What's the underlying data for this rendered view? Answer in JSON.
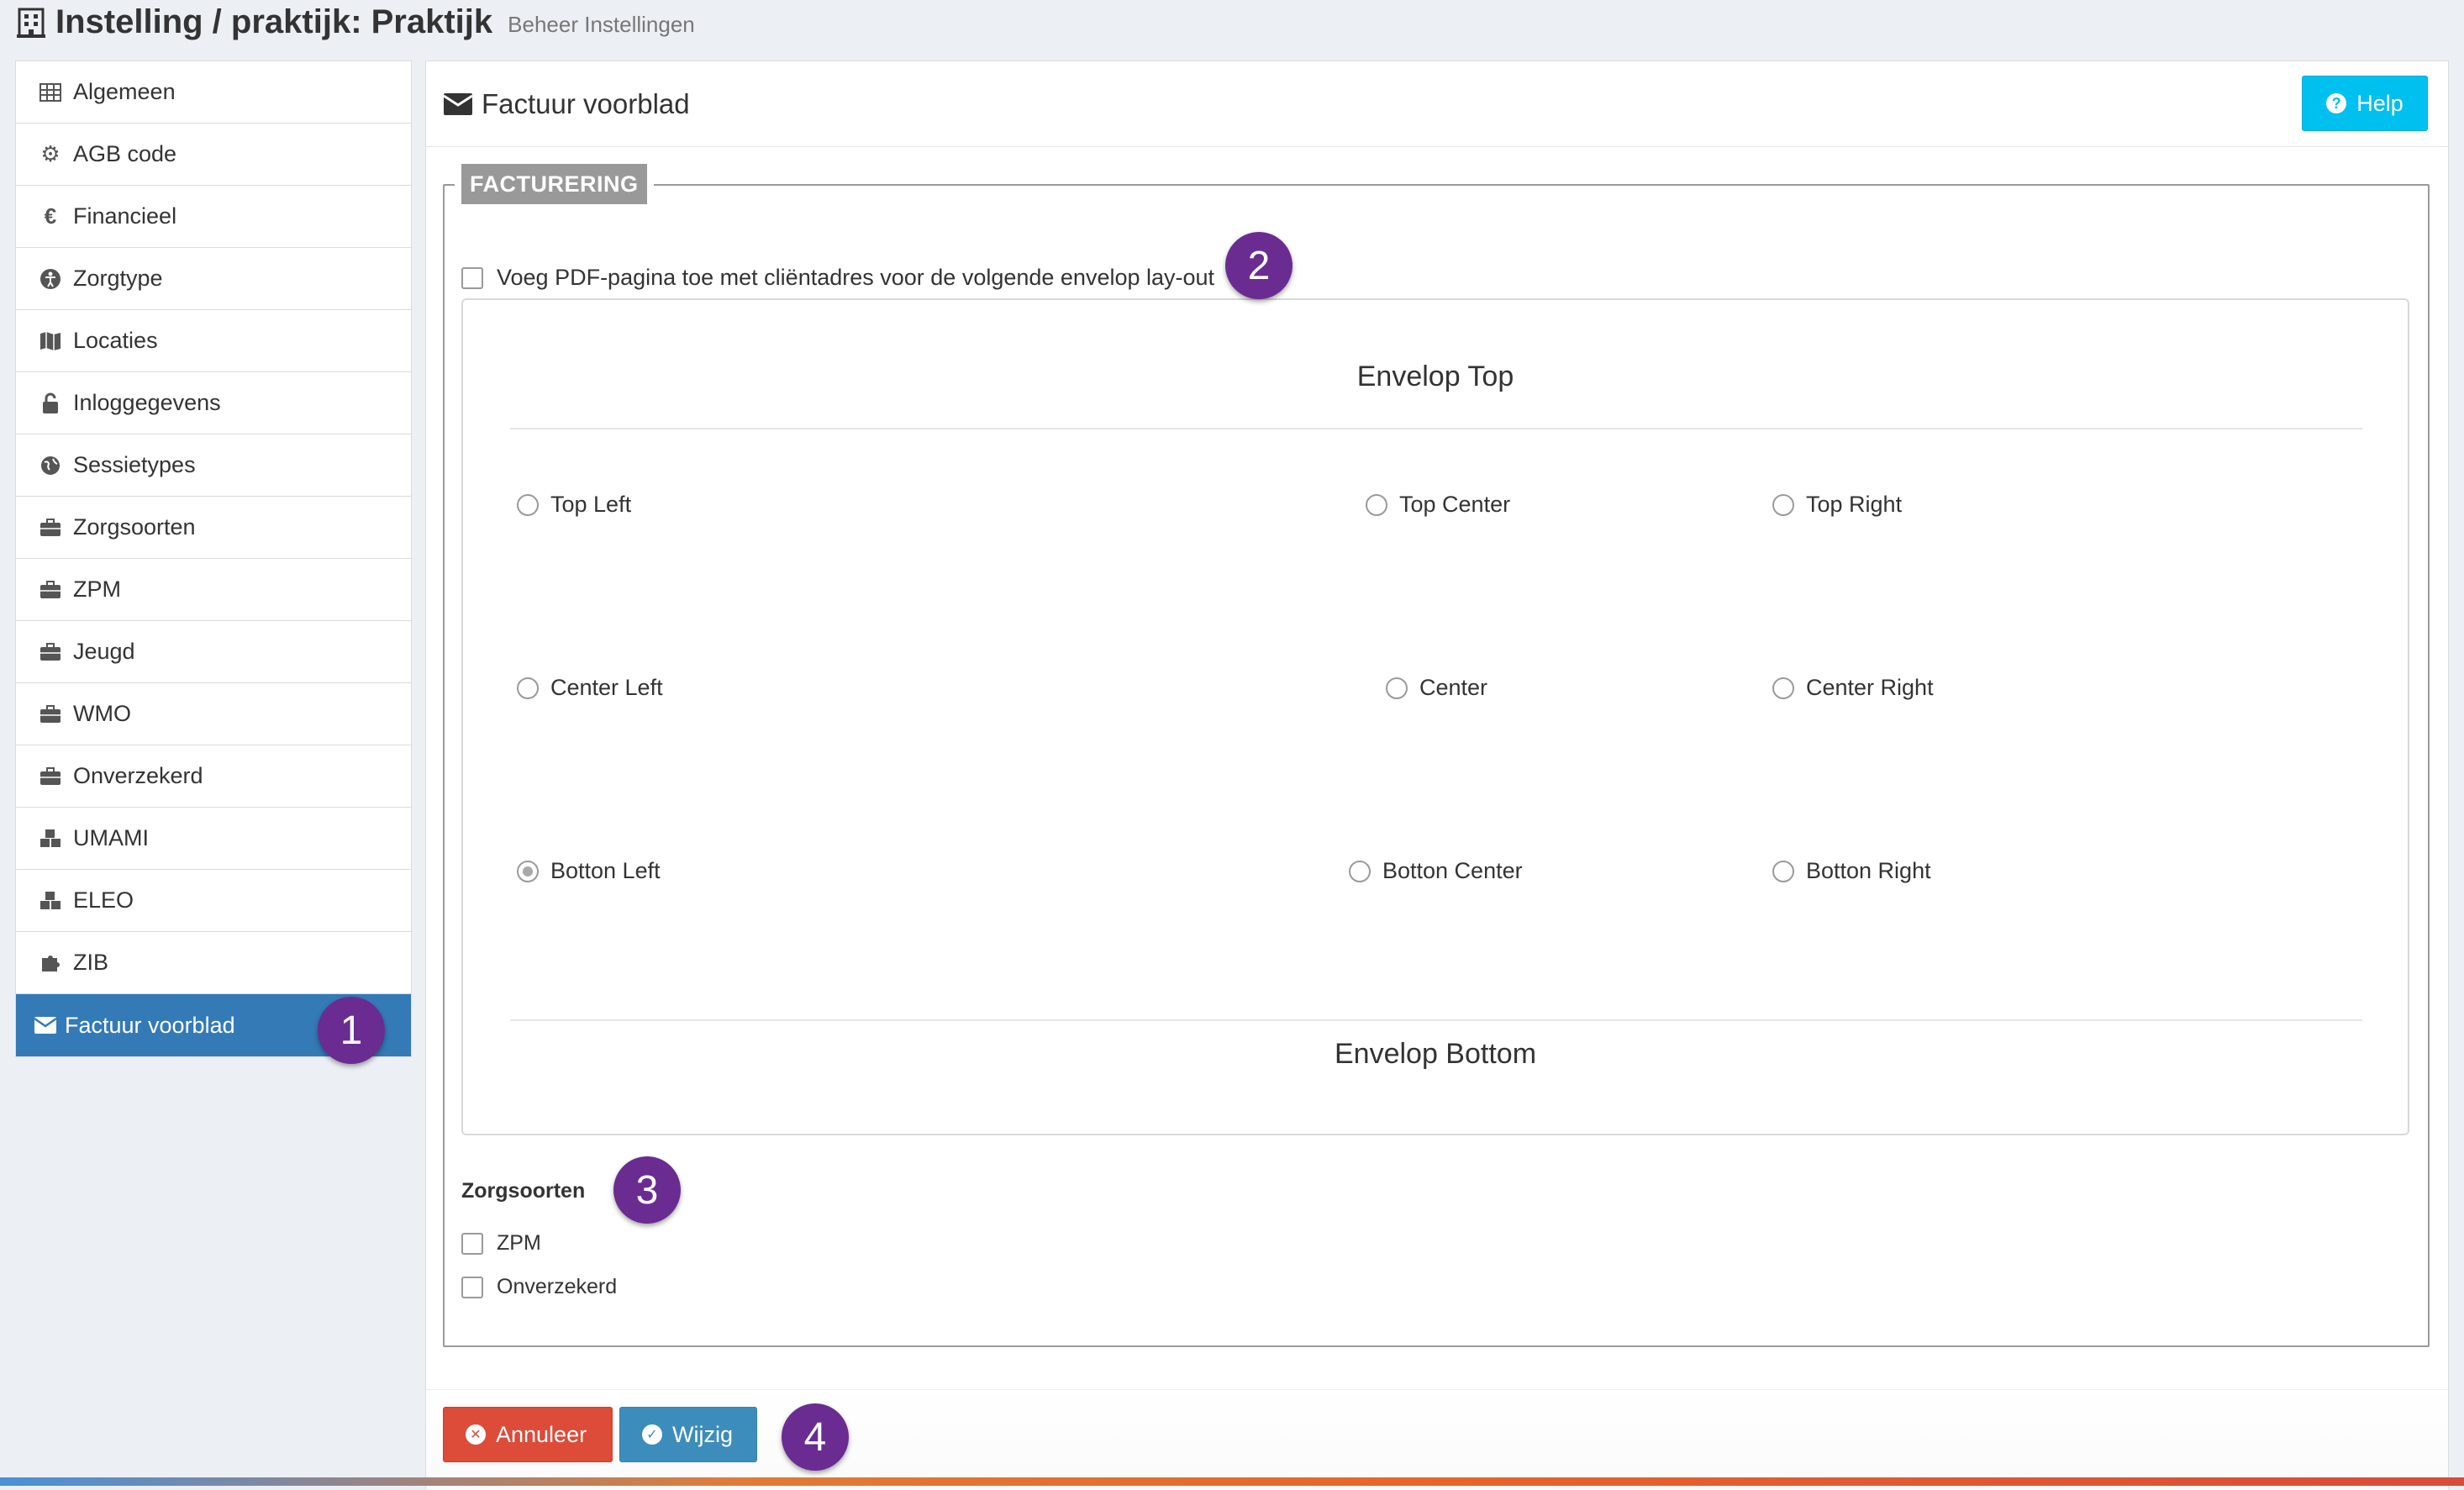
{
  "header": {
    "title": "Instelling / praktijk: Praktijk",
    "subtitle": "Beheer Instellingen",
    "icon": "building-icon"
  },
  "sidebar": {
    "items": [
      {
        "label": "Algemeen",
        "icon": "table-icon"
      },
      {
        "label": "AGB code",
        "icon": "cogs-icon"
      },
      {
        "label": "Financieel",
        "icon": "euro-icon"
      },
      {
        "label": "Zorgtype",
        "icon": "accessibility-icon"
      },
      {
        "label": "Locaties",
        "icon": "map-icon"
      },
      {
        "label": "Inloggegevens",
        "icon": "unlock-icon"
      },
      {
        "label": "Sessietypes",
        "icon": "globe-icon"
      },
      {
        "label": "Zorgsoorten",
        "icon": "briefcase-icon"
      },
      {
        "label": "ZPM",
        "icon": "briefcase-icon"
      },
      {
        "label": "Jeugd",
        "icon": "briefcase-icon"
      },
      {
        "label": "WMO",
        "icon": "briefcase-icon"
      },
      {
        "label": "Onverzekerd",
        "icon": "briefcase-icon"
      },
      {
        "label": "UMAMI",
        "icon": "cubes-icon"
      },
      {
        "label": "ELEO",
        "icon": "cubes-icon"
      },
      {
        "label": "ZIB",
        "icon": "puzzle-icon"
      },
      {
        "label": "Factuur voorblad",
        "icon": "envelope-icon",
        "active": true
      }
    ]
  },
  "panel": {
    "title": "Factuur voorblad",
    "help_label": "Help"
  },
  "facturering": {
    "legend": "FACTURERING",
    "pdf_checkbox_label": "Voeg PDF-pagina toe met cliëntadres voor de volgende envelop lay-out",
    "pdf_checked": false,
    "envelope_top": "Envelop Top",
    "envelope_bottom": "Envelop Bottom",
    "positions": {
      "top_left": "Top Left",
      "top_center": "Top Center",
      "top_right": "Top Right",
      "center_left": "Center Left",
      "center": "Center",
      "center_right": "Center Right",
      "bottom_left": "Botton Left",
      "bottom_center": "Botton Center",
      "bottom_right": "Botton Right"
    },
    "selected_position": "Botton Left",
    "zorgsoorten_title": "Zorgsoorten",
    "zorgsoorten": [
      {
        "label": "ZPM",
        "checked": false
      },
      {
        "label": "Onverzekerd",
        "checked": false
      }
    ]
  },
  "footer": {
    "cancel_label": "Annuleer",
    "save_label": "Wijzig"
  },
  "badges": [
    "1",
    "2",
    "3",
    "4"
  ],
  "colors": {
    "active_item": "#337ab7",
    "help_button": "#00c0ef",
    "cancel_button": "#dd4b39",
    "save_button": "#3c8dbc",
    "badge": "#6a2c91"
  }
}
